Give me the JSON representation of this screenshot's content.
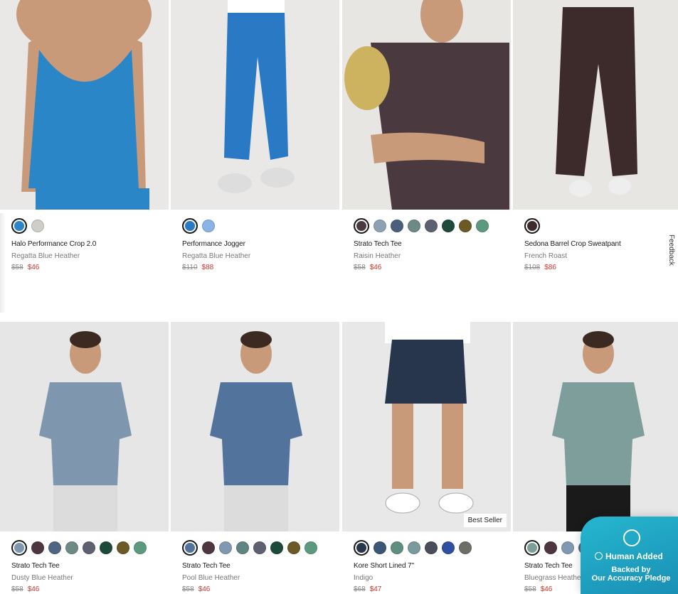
{
  "feedback_label": "Feedback",
  "nav_arrow": "›",
  "products": [
    {
      "name": "Halo Performance Crop 2.0",
      "color": "Regatta Blue Heather",
      "orig": "$58",
      "sale": "$46",
      "bg": "#e9e8e6",
      "swatches": [
        "#2b86c8",
        "#cfcdc8"
      ],
      "badge": ""
    },
    {
      "name": "Performance Jogger",
      "color": "Regatta Blue Heather",
      "orig": "$110",
      "sale": "$88",
      "bg": "#eae8e6",
      "swatches": [
        "#2a79c4",
        "#8ab3e6"
      ],
      "badge": ""
    },
    {
      "name": "Strato Tech Tee",
      "color": "Raisin Heather",
      "orig": "$58",
      "sale": "$46",
      "bg": "#e8e6e3",
      "swatches": [
        "#4a3a40",
        "#8ea1b4",
        "#4b5f7d",
        "#6c8a86",
        "#5d6070",
        "#1d4a3b",
        "#6b5a24",
        "#5c9a80"
      ],
      "badge": ""
    },
    {
      "name": "Sedona Barrel Crop Sweatpant",
      "color": "French Roast",
      "orig": "$108",
      "sale": "$86",
      "bg": "#e8e6e3",
      "swatches": [
        "#3d2a2b"
      ],
      "badge": ""
    },
    {
      "name": "Strato Tech Tee",
      "color": "Dusty Blue Heather",
      "orig": "$58",
      "sale": "$46",
      "bg": "#e6e6e6",
      "swatches": [
        "#7f97ae",
        "#4e3640",
        "#4f6682",
        "#6e8a85",
        "#5e6072",
        "#1b4a3a",
        "#6b5a25",
        "#5c9a80"
      ],
      "badge": ""
    },
    {
      "name": "Strato Tech Tee",
      "color": "Pool Blue Heather",
      "orig": "$58",
      "sale": "$46",
      "bg": "#e7e7e7",
      "swatches": [
        "#51739c",
        "#4e3640",
        "#8099b2",
        "#5f8482",
        "#5e6072",
        "#1b4a3a",
        "#6b5a25",
        "#5c9a80"
      ],
      "badge": ""
    },
    {
      "name": "Kore Short Lined 7\"",
      "color": "Indigo",
      "orig": "$68",
      "sale": "$47",
      "bg": "#e8e8e8",
      "swatches": [
        "#27354d",
        "#3c5675",
        "#5f8f80",
        "#7a9a9e",
        "#4a4e5a",
        "#2f4fa0",
        "#6b6f66"
      ],
      "badge": "Best Seller"
    },
    {
      "name": "Strato Tech Tee",
      "color": "Bluegrass Heather",
      "orig": "$58",
      "sale": "$46",
      "bg": "#e7e7e7",
      "swatches": [
        "#7d9e9a",
        "#4e3640",
        "#8099b2",
        "#5a6c80",
        "#4f6682",
        "#5e6072",
        "#1b4a3a",
        "#5c9a80"
      ],
      "badge": ""
    }
  ],
  "promo": {
    "line1": "Human Added",
    "line2": "Backed by",
    "line3": "Our Accuracy Pledge"
  }
}
